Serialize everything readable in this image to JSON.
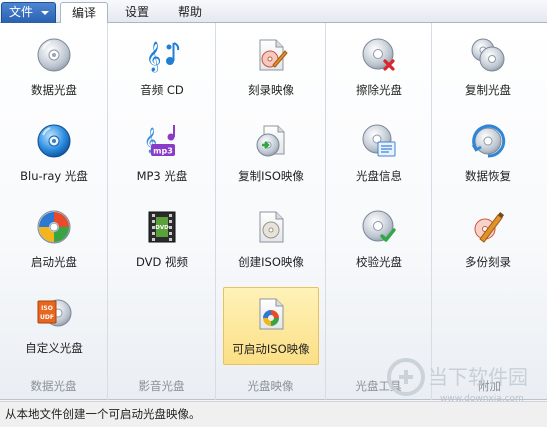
{
  "tabs": {
    "file_label": "文件",
    "items": [
      {
        "label": "编译",
        "active": true
      },
      {
        "label": "设置",
        "active": false
      },
      {
        "label": "帮助",
        "active": false
      }
    ]
  },
  "groups": [
    {
      "label": "数据光盘",
      "buttons": [
        {
          "label": "数据光盘",
          "icon": "data-disc-icon"
        },
        {
          "label": "Blu-ray 光盘",
          "icon": "bluray-disc-icon"
        },
        {
          "label": "启动光盘",
          "icon": "boot-disc-icon"
        },
        {
          "label": "自定义光盘",
          "icon": "iso-udf-disc-icon"
        }
      ]
    },
    {
      "label": "影音光盘",
      "buttons": [
        {
          "label": "音频 CD",
          "icon": "audio-cd-icon"
        },
        {
          "label": "MP3 光盘",
          "icon": "mp3-disc-icon"
        },
        {
          "label": "DVD 视频",
          "icon": "dvd-video-icon"
        }
      ]
    },
    {
      "label": "光盘映像",
      "buttons": [
        {
          "label": "刻录映像",
          "icon": "burn-image-icon"
        },
        {
          "label": "复制ISO映像",
          "icon": "copy-iso-icon"
        },
        {
          "label": "创建ISO映像",
          "icon": "create-iso-icon"
        },
        {
          "label": "可启动ISO映像",
          "icon": "bootable-iso-icon",
          "selected": true
        }
      ]
    },
    {
      "label": "光盘工具",
      "buttons": [
        {
          "label": "擦除光盘",
          "icon": "erase-disc-icon"
        },
        {
          "label": "光盘信息",
          "icon": "disc-info-icon"
        },
        {
          "label": "校验光盘",
          "icon": "verify-disc-icon"
        }
      ]
    },
    {
      "label": "附加",
      "buttons": [
        {
          "label": "复制光盘",
          "icon": "copy-disc-icon"
        },
        {
          "label": "数据恢复",
          "icon": "data-recovery-icon"
        },
        {
          "label": "多份刻录",
          "icon": "multi-burn-icon"
        }
      ]
    }
  ],
  "statusbar": {
    "text": "从本地文件创建一个可启动光盘映像。"
  },
  "watermark": {
    "text": "当下软件园",
    "url": "www.downxia.com"
  },
  "colors": {
    "file_button": "#2a5fb0",
    "selected_button": "#fbdf86",
    "disc_silver": "#c9ced6"
  }
}
